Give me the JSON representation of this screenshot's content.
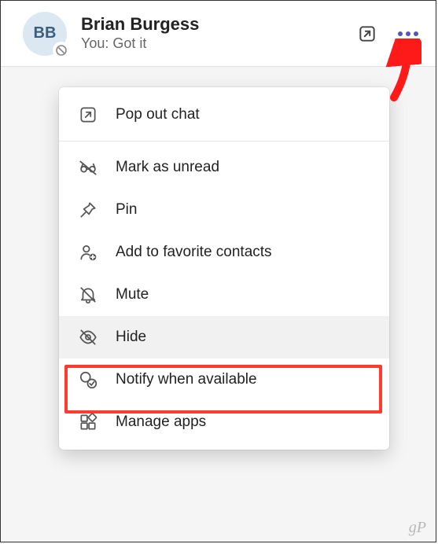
{
  "avatar": {
    "initials": "BB"
  },
  "contact": {
    "name": "Brian Burgess",
    "preview": "You: Got it"
  },
  "menu": {
    "popout": "Pop out chat",
    "mark_unread": "Mark as unread",
    "pin": "Pin",
    "add_favorite": "Add to favorite contacts",
    "mute": "Mute",
    "hide": "Hide",
    "notify_available": "Notify when available",
    "manage_apps": "Manage apps"
  },
  "watermark": "gP"
}
